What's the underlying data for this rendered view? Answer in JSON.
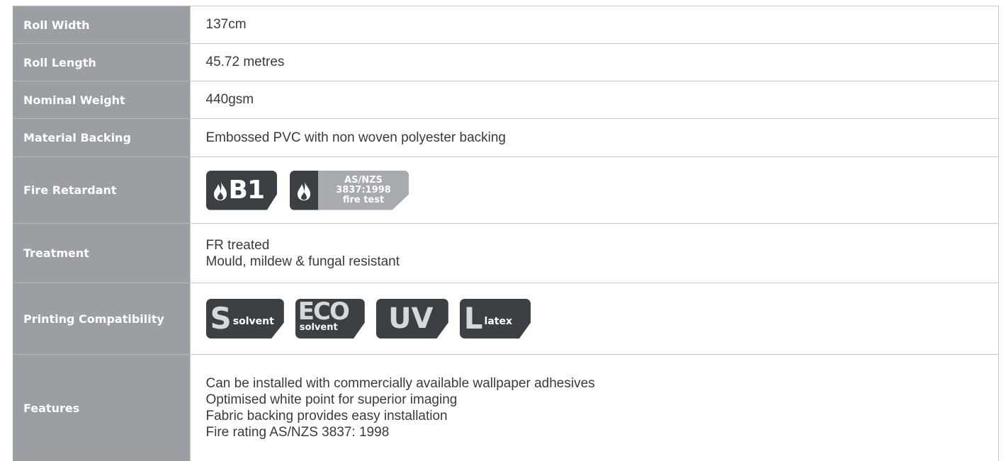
{
  "rows": [
    {
      "label": "Roll Width",
      "value": "137cm"
    },
    {
      "label": "Roll Length",
      "value": "45.72 metres"
    },
    {
      "label": "Nominal Weight",
      "value": "440gsm"
    },
    {
      "label": "Material Backing",
      "value": "Embossed PVC with non woven polyester backing"
    },
    {
      "label": "Fire Retardant"
    },
    {
      "label": "Treatment",
      "lines": [
        "FR treated",
        "Mould, mildew & fungal resistant"
      ]
    },
    {
      "label": "Printing Compatibility"
    },
    {
      "label": "Features",
      "lines": [
        "Can be installed with commercially available wallpaper adhesives",
        "Optimised white point for superior imaging",
        "Fabric backing provides easy installation",
        "Fire rating AS/NZS 3837: 1998"
      ]
    }
  ],
  "fire_badges": {
    "b1": "B1",
    "asnzs": [
      "AS/NZS",
      "3837:1998",
      "fire test"
    ]
  },
  "print_badges": {
    "solvent": {
      "letter": "S",
      "text": "solvent"
    },
    "eco": {
      "letter": "ECO",
      "text": "solvent"
    },
    "uv": {
      "letter": "UV"
    },
    "latex": {
      "letter": "L",
      "text": "latex"
    }
  },
  "colors": {
    "label_bg": "#9b9ea2",
    "badge_dark": "#3b4045",
    "badge_grey": "#a7aaae",
    "text": "#3a3a3a"
  }
}
